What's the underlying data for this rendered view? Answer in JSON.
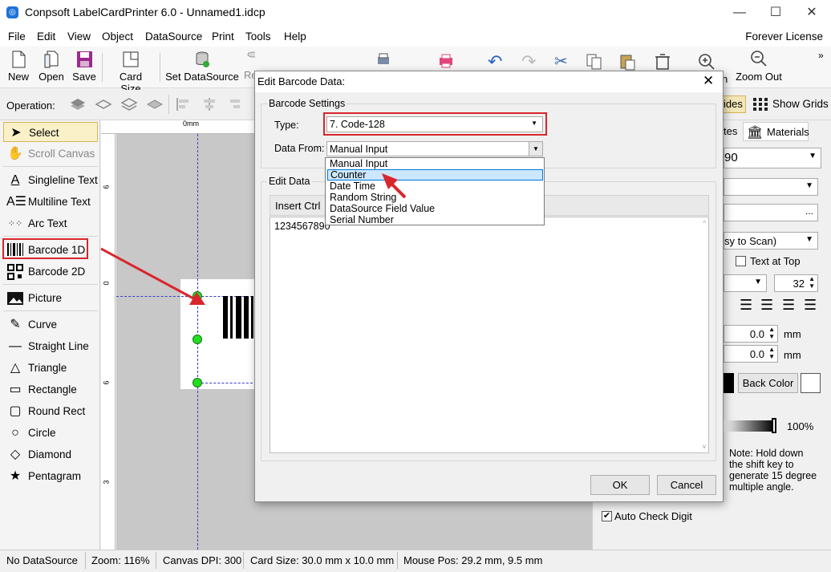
{
  "window": {
    "title": "Conpsoft LabelCardPrinter 6.0 - Unnamed1.idcp",
    "license": "Forever License"
  },
  "menu": [
    "File",
    "Edit",
    "View",
    "Object",
    "DataSource",
    "Print",
    "Tools",
    "Help"
  ],
  "toolbar": {
    "new": "New",
    "open": "Open",
    "save": "Save",
    "card_size": "Card Size",
    "set_datasource": "Set DataSource",
    "re": "Re",
    "zoom_in_partial": "n",
    "zoom_out": "Zoom Out"
  },
  "operation": {
    "label": "Operation:",
    "guides_partial": "ides",
    "show_grids": "Show Grids"
  },
  "tools": [
    {
      "label": "Select",
      "icon": "pointer-icon"
    },
    {
      "label": "Scroll Canvas",
      "icon": "hand-icon"
    },
    {
      "label": "Singleline Text",
      "icon": "singleline-text-icon"
    },
    {
      "label": "Multiline Text",
      "icon": "multiline-text-icon"
    },
    {
      "label": "Arc Text",
      "icon": "arc-text-icon"
    },
    {
      "label": "Barcode 1D",
      "icon": "barcode-1d-icon"
    },
    {
      "label": "Barcode 2D",
      "icon": "qrcode-icon"
    },
    {
      "label": "Picture",
      "icon": "picture-icon"
    },
    {
      "label": "Curve",
      "icon": "curve-icon"
    },
    {
      "label": "Straight Line",
      "icon": "line-icon"
    },
    {
      "label": "Triangle",
      "icon": "triangle-icon"
    },
    {
      "label": "Rectangle",
      "icon": "rectangle-icon"
    },
    {
      "label": "Round Rect",
      "icon": "round-rect-icon"
    },
    {
      "label": "Circle",
      "icon": "circle-icon"
    },
    {
      "label": "Diamond",
      "icon": "diamond-icon"
    },
    {
      "label": "Pentagram",
      "icon": "star-icon"
    }
  ],
  "ruler": {
    "top_label": "0mm",
    "left_labels": [
      "6",
      "0",
      "6",
      "3"
    ]
  },
  "right_panel": {
    "tab_partial": "tes",
    "materials": "Materials",
    "field1_partial": "90",
    "field2_partial": "sy to Scan)",
    "text_at_top": "Text at Top",
    "font_size": "32",
    "offset1": "0.0",
    "offset2": "0.0",
    "unit": "mm",
    "back_color": "Back Color",
    "opacity": "100%",
    "note": "Note: Hold down the shift key to generate 15 degree multiple angle.",
    "auto_check_digit": "Auto Check Digit"
  },
  "status": {
    "datasource": "No DataSource",
    "zoom": "Zoom: 116%",
    "dpi": "Canvas DPI: 300",
    "card_size": "Card Size: 30.0 mm x 10.0 mm",
    "mouse_pos": "Mouse Pos: 29.2 mm, 9.5 mm"
  },
  "dialog": {
    "title": "Edit Barcode Data:",
    "barcode_settings": "Barcode Settings",
    "type_label": "Type:",
    "type_value": "7.  Code-128",
    "data_from_label": "Data From:",
    "data_from_value": "Manual Input",
    "data_from_options": [
      "Manual Input",
      "Counter",
      "Date Time",
      "Random String",
      "DataSource Field Value",
      "Serial Number"
    ],
    "highlighted_option": "Counter",
    "edit_data": "Edit Data",
    "insert_ctrl": "Insert Ctrl",
    "text_value": "1234567890",
    "ok": "OK",
    "cancel": "Cancel"
  },
  "colors": {
    "accent_red": "#d9262c",
    "handle_green": "#22dd22",
    "highlight": "#cce8ff"
  }
}
